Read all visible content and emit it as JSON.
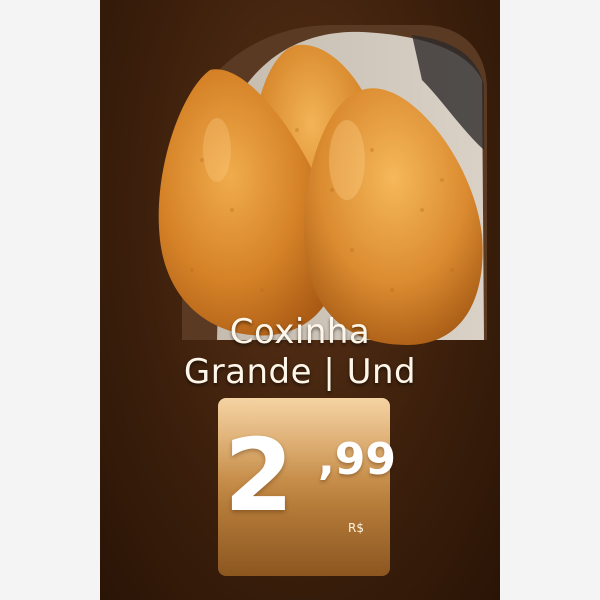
{
  "product": {
    "name_line1": "Coxinha",
    "name_line2": "Grande | Und",
    "image_icon": "coxinha-photo"
  },
  "price": {
    "integer": "2",
    "decimals": ",99",
    "currency": "R$"
  },
  "colors": {
    "background": "#3d200c",
    "price_tag_top": "#f3c98e",
    "price_tag_bottom": "#8c5620",
    "text": "#fff6ea",
    "pastry": "#d9822e"
  }
}
